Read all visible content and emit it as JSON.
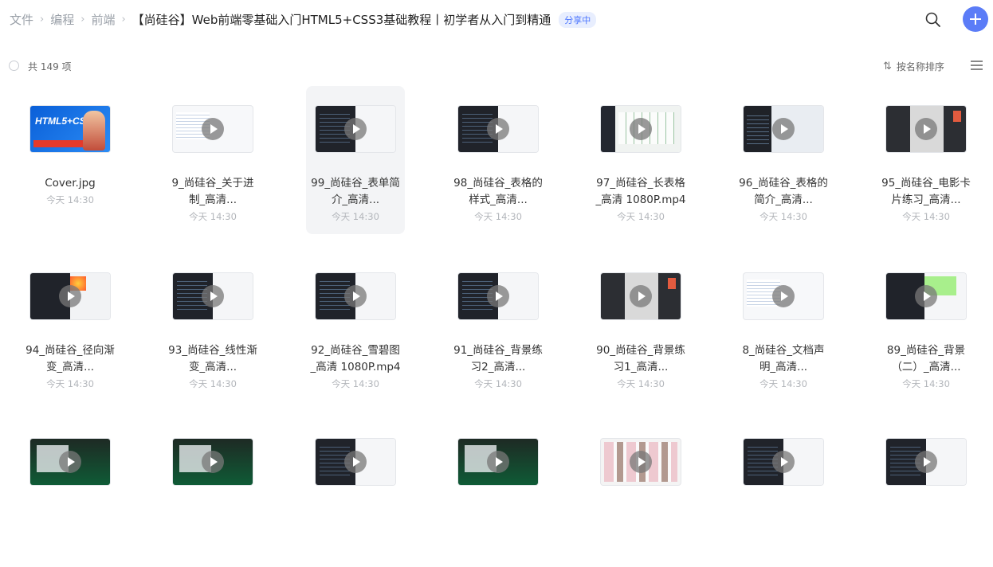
{
  "header": {
    "breadcrumbs": [
      "文件",
      "编程",
      "前端"
    ],
    "current_folder": "【尚硅谷】Web前端零基础入门HTML5+CSS3基础教程丨初学者从入门到精通",
    "share_badge": "分享中"
  },
  "toolbar": {
    "count": "共 149 项",
    "sort_label": "按名称排序"
  },
  "files": [
    {
      "name": "Cover.jpg",
      "time": "今天 14:30",
      "thumb": "cover",
      "is_video": false,
      "cover_text": "HTML5+CSS3"
    },
    {
      "name": "9_尚硅谷_关于进制_高清...",
      "time": "今天 14:30",
      "thumb": "white",
      "is_video": true
    },
    {
      "name": "99_尚硅谷_表单简介_高清...",
      "time": "今天 14:30",
      "thumb": "dark",
      "is_video": true,
      "hover": true
    },
    {
      "name": "98_尚硅谷_表格的样式_高清...",
      "time": "今天 14:30",
      "thumb": "dark",
      "is_video": true
    },
    {
      "name": "97_尚硅谷_长表格_高清 1080P.mp4",
      "time": "今天 14:30",
      "thumb": "excel",
      "is_video": true
    },
    {
      "name": "96_尚硅谷_表格的简介_高清...",
      "time": "今天 14:30",
      "thumb": "dark2",
      "is_video": true
    },
    {
      "name": "95_尚硅谷_电影卡片练习_高清...",
      "time": "今天 14:30",
      "thumb": "photo",
      "is_video": true
    },
    {
      "name": "94_尚硅谷_径向渐变_高清...",
      "time": "今天 14:30",
      "thumb": "grad",
      "is_video": true
    },
    {
      "name": "93_尚硅谷_线性渐变_高清...",
      "time": "今天 14:30",
      "thumb": "dark",
      "is_video": true
    },
    {
      "name": "92_尚硅谷_雪碧图_高清 1080P.mp4",
      "time": "今天 14:30",
      "thumb": "dark",
      "is_video": true
    },
    {
      "name": "91_尚硅谷_背景练习2_高清...",
      "time": "今天 14:30",
      "thumb": "dark",
      "is_video": true
    },
    {
      "name": "90_尚硅谷_背景练习1_高清...",
      "time": "今天 14:30",
      "thumb": "photo",
      "is_video": true
    },
    {
      "name": "8_尚硅谷_文档声明_高清...",
      "time": "今天 14:30",
      "thumb": "white",
      "is_video": true
    },
    {
      "name": "89_尚硅谷_背景（二）_高清...",
      "time": "今天 14:30",
      "thumb": "greenbox",
      "is_video": true
    },
    {
      "name": "",
      "time": "",
      "thumb": "green",
      "is_video": true
    },
    {
      "name": "",
      "time": "",
      "thumb": "green",
      "is_video": true
    },
    {
      "name": "",
      "time": "",
      "thumb": "dark",
      "is_video": true
    },
    {
      "name": "",
      "time": "",
      "thumb": "green",
      "is_video": true
    },
    {
      "name": "",
      "time": "",
      "thumb": "shop",
      "is_video": true
    },
    {
      "name": "",
      "time": "",
      "thumb": "dark",
      "is_video": true
    },
    {
      "name": "",
      "time": "",
      "thumb": "dark",
      "is_video": true
    }
  ],
  "icons": {
    "search": "search-icon",
    "add": "plus-icon",
    "sort": "sort-icon",
    "view": "list-view-icon",
    "play": "play-icon"
  },
  "colors": {
    "accent": "#5b7cf7",
    "badge_text": "#4a74ff",
    "badge_bg": "#e8eefe",
    "muted_text": "#b3b6bb"
  }
}
